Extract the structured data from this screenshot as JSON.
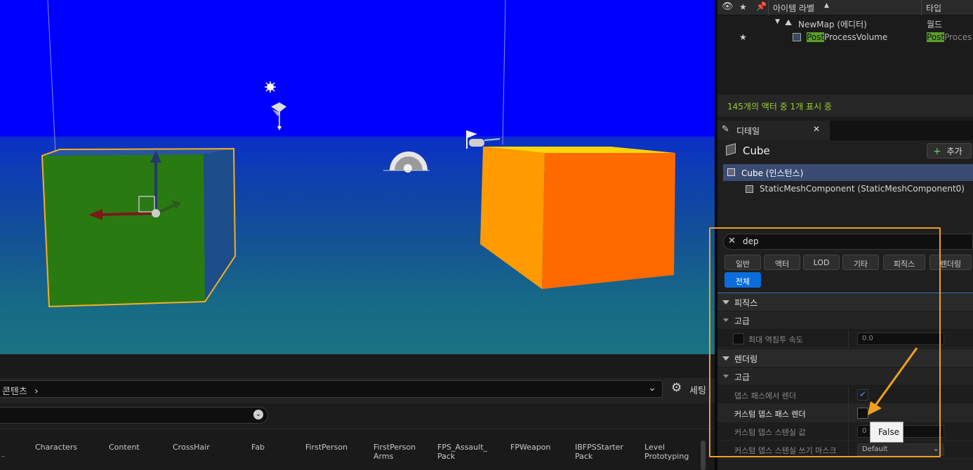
{
  "colors": {
    "sky": "#0000ff",
    "accent": "#0a6ddb",
    "highlight": "#f0a020",
    "selected_row": "#3a4c73",
    "status_green": "#9acd32",
    "cube_green": "#2a7a12",
    "cube_orange": "#ff7a00"
  },
  "viewport": {
    "icons": [
      "sun-icon",
      "directional-light-icon",
      "player-start-icon",
      "sky-sphere-icon",
      "transform-gizmo-icon"
    ]
  },
  "content_browser": {
    "path_label": "콘텐츠",
    "settings_label": "세팅",
    "folders": [
      "Characters",
      "Content",
      "CrossHair",
      "Fab",
      "FirstPerson",
      "FirstPerson Arms",
      "FPS_Assault_ Pack",
      "FPWeapon",
      "IBFPSStarter Pack",
      "Level Prototyping"
    ]
  },
  "outliner": {
    "col_label": "아이템 라벨",
    "col_type": "타입",
    "rows": [
      {
        "label": "NewMap (에디터)",
        "type": "월드"
      },
      {
        "label_match": "Post",
        "label_rest": "ProcessVolume",
        "type_match": "Post",
        "type_rest": "Proces"
      }
    ],
    "status": "145개의 액터 중 1개 표시 중"
  },
  "details": {
    "tab_label": "디테일",
    "actor_name": "Cube",
    "add_label": "추가",
    "components": [
      "Cube (인스턴스)",
      "StaticMeshComponent (StaticMeshComponent0)"
    ],
    "search_value": "dep",
    "categories": [
      "일반",
      "액터",
      "LOD",
      "기타",
      "피직스",
      "렌더링"
    ],
    "category_all": "전체",
    "sections": [
      {
        "name": "피직스",
        "sub": "고급",
        "props": [
          {
            "label": "최대 역침투 속도",
            "value": "0.0"
          }
        ]
      },
      {
        "name": "렌더링",
        "sub": "고급",
        "props": [
          {
            "label": "뎁스 패스에서 렌더",
            "checked": true
          },
          {
            "label": "커스텀 뎁스 패스 렌더",
            "checked": false
          },
          {
            "label": "커스텀 뎁스 스텐실 값",
            "value": "0"
          },
          {
            "label": "커스텀 뎁스 스텐실 쓰기 마스크",
            "value": "Default"
          }
        ]
      }
    ],
    "tooltip": "False"
  }
}
